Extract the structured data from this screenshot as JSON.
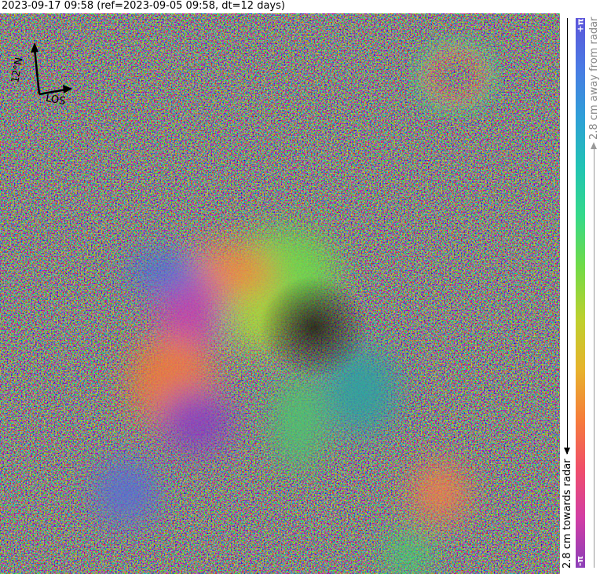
{
  "title": "2023-09-17 09:58 (ref=2023-09-05 09:58, dt=12 days)",
  "compass": {
    "north_label": "12°N",
    "los_label": "LOS"
  },
  "colorbar": {
    "top_label": "+π",
    "bottom_label": "-π",
    "away_label": "2.8 cm away from radar",
    "towards_label": "2.8 cm towards radar",
    "colors": [
      "#5d55da",
      "#4a7ae4",
      "#2f9fd8",
      "#21c3b4",
      "#35d98a",
      "#6fdb48",
      "#bfd02d",
      "#e7b32c",
      "#f67d3a",
      "#f04f6a",
      "#d23ea5",
      "#8c3fb8"
    ]
  }
}
